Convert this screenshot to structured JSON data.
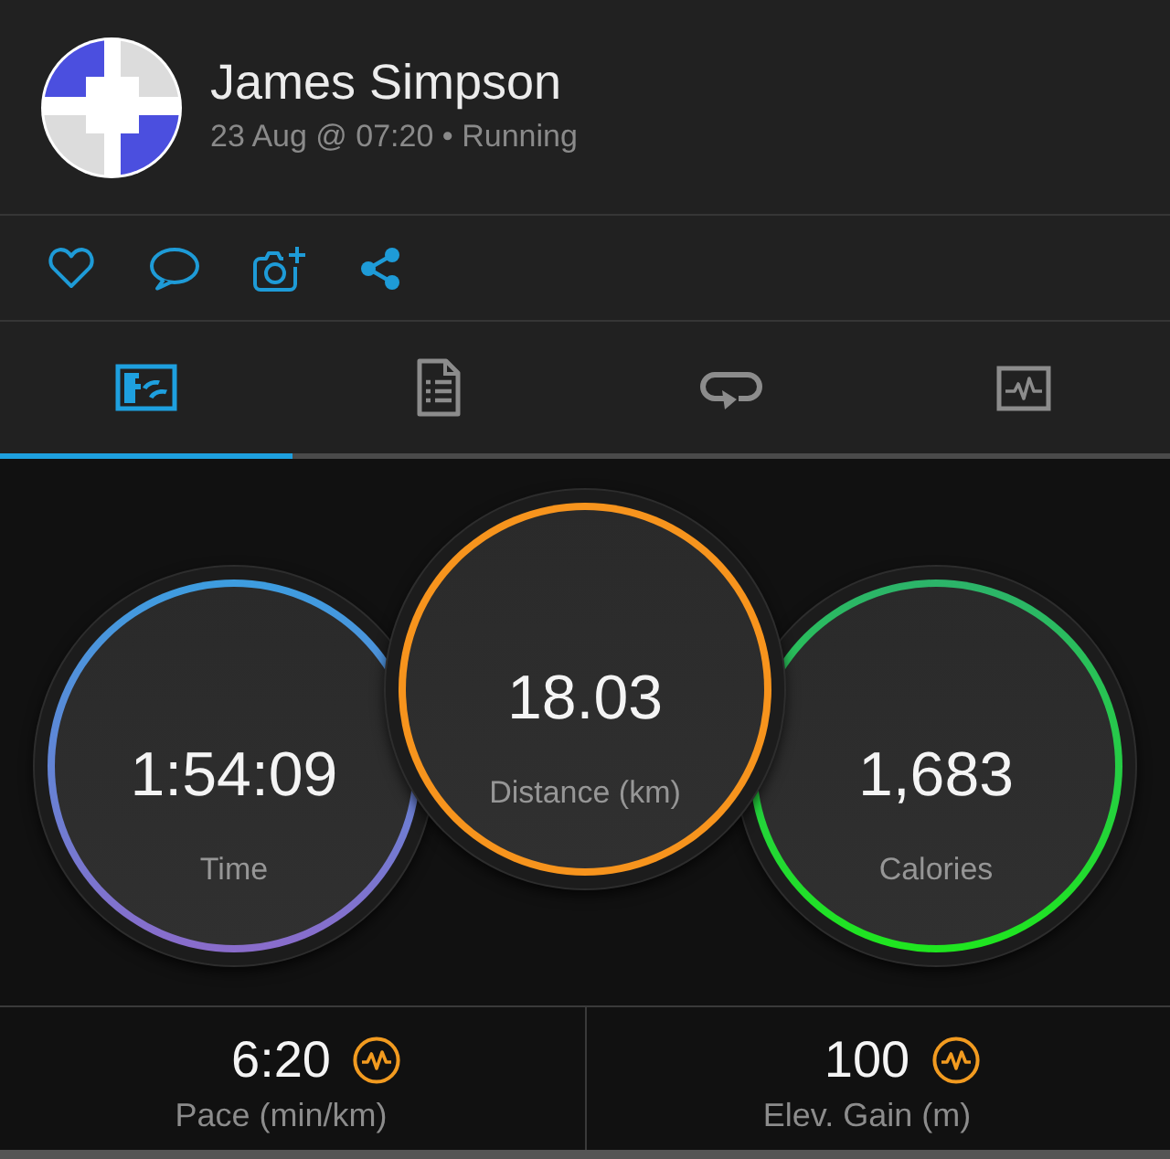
{
  "profile": {
    "name": "James Simpson",
    "subtitle": "23 Aug @ 07:20 • Running"
  },
  "tabs": [
    {
      "selected": true
    },
    {
      "selected": false
    },
    {
      "selected": false
    },
    {
      "selected": false
    }
  ],
  "summary": [
    {
      "value": "1:54:09",
      "label": "Time",
      "ring_gradient": [
        {
          "color": "#3d9de0"
        },
        {
          "color": "#8a6ccb"
        }
      ]
    },
    {
      "value": "18.03",
      "label": "Distance (km)",
      "ring_gradient": [
        {
          "color": "#f7941d"
        }
      ]
    },
    {
      "value": "1,683",
      "label": "Calories",
      "ring_gradient": [
        {
          "color": "#2cb46a"
        },
        {
          "color": "#1fe61f"
        }
      ]
    }
  ],
  "metrics": [
    {
      "value": "6:20",
      "label": "Pace (min/km)"
    },
    {
      "value": "100",
      "label": "Elev. Gain (m)"
    }
  ]
}
